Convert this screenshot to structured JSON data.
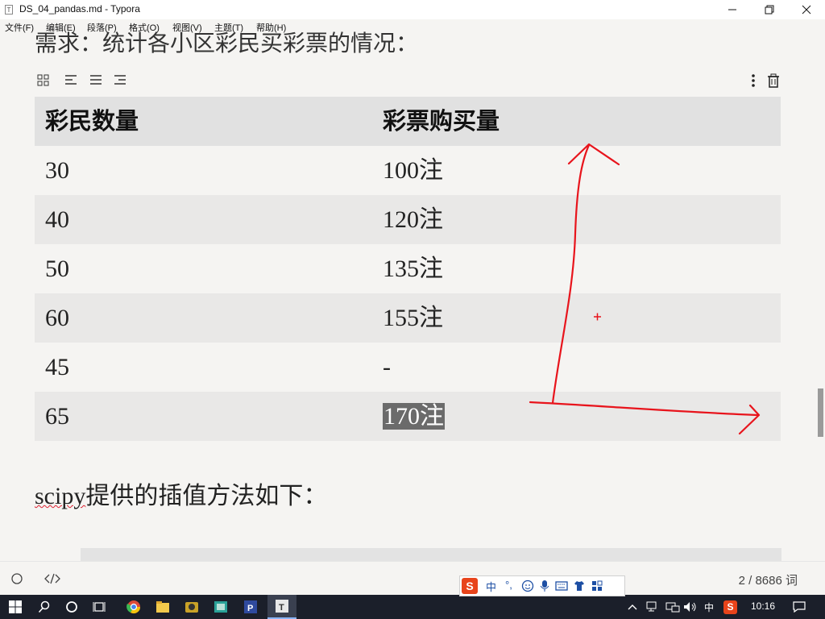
{
  "window": {
    "title": "DS_04_pandas.md - Typora",
    "app_icon_letter": "T"
  },
  "menu": [
    "文件(F)",
    "编辑(E)",
    "段落(P)",
    "格式(O)",
    "视图(V)",
    "主题(T)",
    "帮助(H)"
  ],
  "document": {
    "heading": "需求：统计各小区彩民买彩票的情况：",
    "table": {
      "headers": [
        "彩民数量",
        "彩票购买量"
      ],
      "rows": [
        [
          "30",
          "100注"
        ],
        [
          "40",
          "120注"
        ],
        [
          "50",
          "135注"
        ],
        [
          "60",
          "155注"
        ],
        [
          "45",
          "-"
        ],
        [
          "65",
          "170注"
        ]
      ],
      "selected_cell_text": "170注"
    },
    "paragraph": {
      "word": "scipy",
      "rest": "提供的插值方法如下："
    }
  },
  "status": {
    "word_count": "2 / 8686 词"
  },
  "ime": {
    "mode": "中",
    "punct": "°,"
  },
  "taskbar": {
    "ime_indicator": "中",
    "clock": "10:16"
  },
  "colors": {
    "annotation": "#e8141c",
    "selection": "#6b6b6b",
    "header_bg": "#e1e1e1",
    "stripe_bg": "#e9e8e7"
  }
}
